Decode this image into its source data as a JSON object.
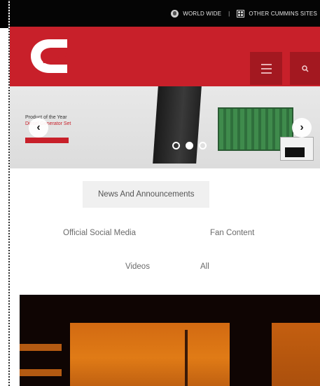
{
  "topbar": {
    "world_wide": "WORLD WIDE",
    "separator": "|",
    "other_sites": "OTHER CUMMINS SITES"
  },
  "header": {
    "brand_color": "#c8202a",
    "menu_icon": "hamburger-icon",
    "search_icon": "search-icon"
  },
  "hero": {
    "headline": "Product of the Year",
    "subline": "Diesel Generator Set",
    "prev_icon": "chevron-left-icon",
    "next_icon": "chevron-right-icon",
    "slides": 3,
    "active_slide": 2
  },
  "filters": {
    "tabs": [
      {
        "label": "News And Announcements",
        "active": true
      },
      {
        "label": "Official Social Media",
        "active": false
      },
      {
        "label": "Fan Content",
        "active": false
      },
      {
        "label": "Videos",
        "active": false
      },
      {
        "label": "All",
        "active": false
      }
    ]
  }
}
